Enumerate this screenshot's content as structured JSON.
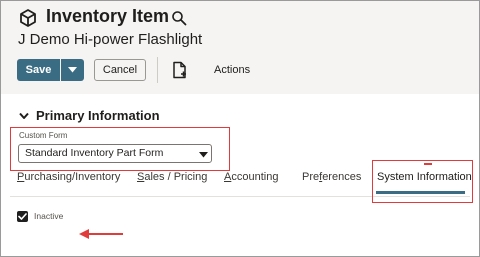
{
  "header": {
    "record_type": "Inventory Item",
    "record_name": "J Demo Hi-power Flashlight"
  },
  "toolbar": {
    "save_label": "Save",
    "cancel_label": "Cancel",
    "actions_label": "Actions"
  },
  "section": {
    "title": "Primary Information"
  },
  "custom_form": {
    "label": "Custom Form",
    "value": "Standard Inventory Part Form"
  },
  "tabs": [
    {
      "label_pre": "",
      "access_key": "P",
      "label_post": "urchasing/Inventory",
      "active": false
    },
    {
      "label_pre": "",
      "access_key": "S",
      "label_post": "ales / Pricing",
      "active": false
    },
    {
      "label_pre": "",
      "access_key": "A",
      "label_post": "ccounting",
      "active": false
    },
    {
      "label_pre": "Pre",
      "access_key": "f",
      "label_post": "erences",
      "active": false
    },
    {
      "label_pre": "",
      "access_key": "",
      "label_post": "System Information",
      "active": true
    }
  ],
  "system_info": {
    "inactive_label": "Inactive",
    "inactive_checked": true
  },
  "colors": {
    "accent": "#3a6d84",
    "highlight": "#e03c3c"
  },
  "icons": [
    "record-cube-icon",
    "search-icon",
    "chevron-down-icon",
    "new-document-icon",
    "checkmark-icon",
    "annotation-arrow-icon"
  ]
}
